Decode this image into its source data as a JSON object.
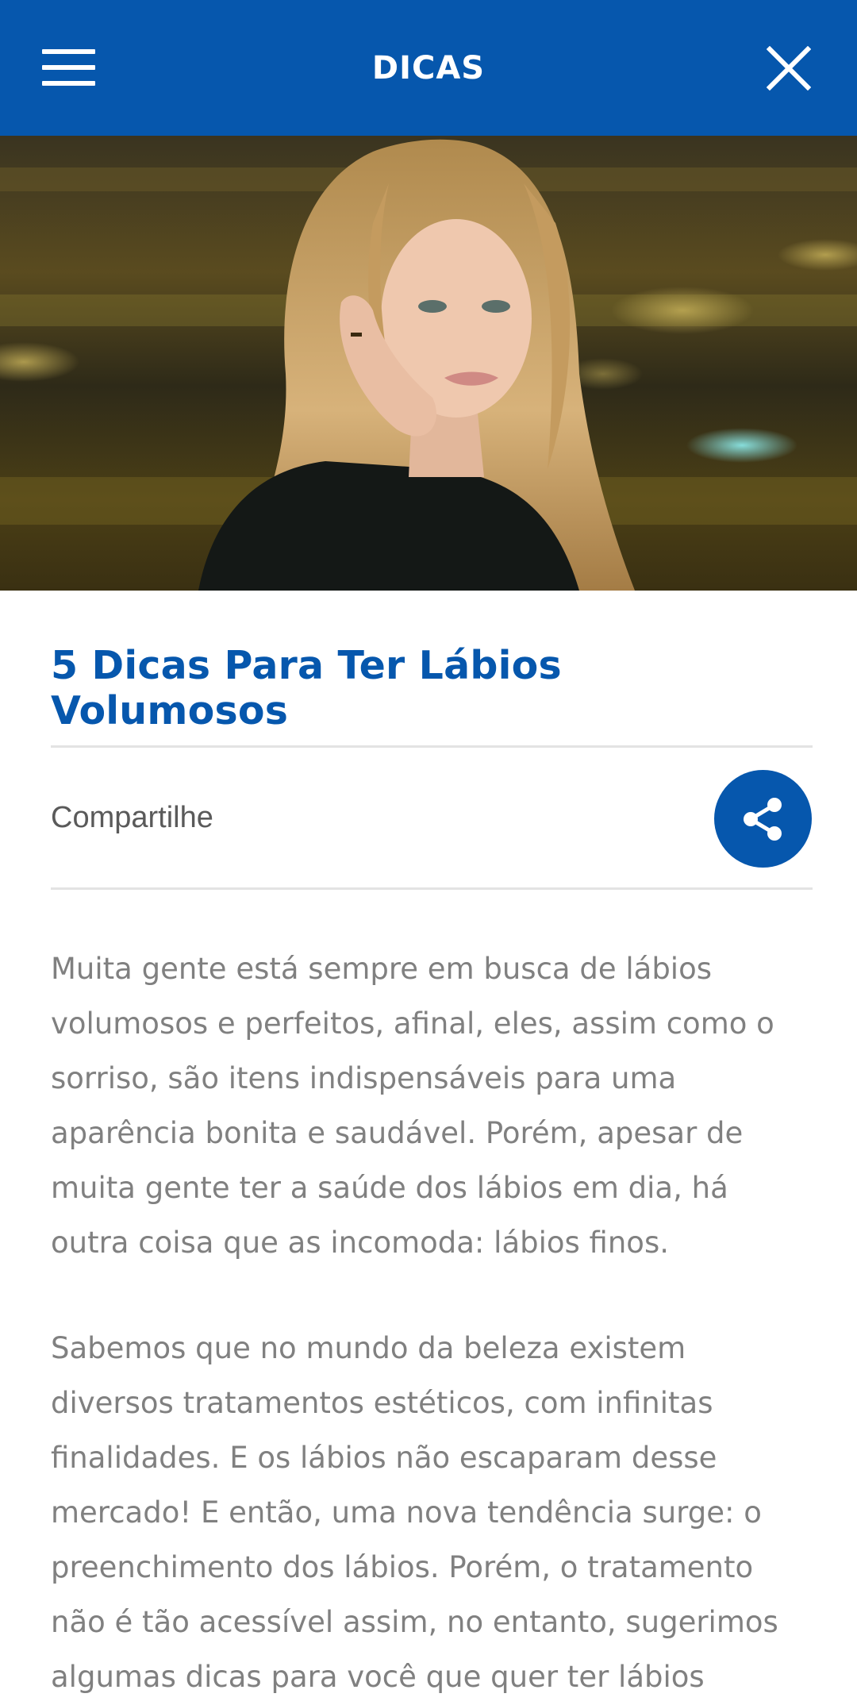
{
  "header": {
    "title": "DICAS",
    "menu_icon": "hamburger-menu-icon",
    "close_icon": "close-icon",
    "background_color": "#0657ad"
  },
  "hero": {
    "image": "woman with long blonde hair resting chin on hand, blurred city lights background"
  },
  "article": {
    "title": "5 Dicas Para Ter Lábios Volumosos",
    "share_label": "Compartilhe",
    "share_icon": "share-icon",
    "paragraphs": [
      "Muita gente está sempre em busca de lábios volumosos e perfeitos, afinal, eles, assim como o sorriso, são itens indispensáveis para uma aparência bonita e saudável. Porém, apesar de muita gente ter a saúde dos lábios em dia, há outra coisa que as incomoda: lábios finos.",
      "Sabemos que no mundo da beleza existem diversos tratamentos estéticos, com infinitas finalidades. E os lábios não escaparam desse mercado! E então, uma nova tendência surge: o preenchimento dos lábios. Porém, o tratamento não é tão acessível assim, no entanto, sugerimos algumas dicas para você que quer ter lábios volumosos com apenas"
    ]
  }
}
